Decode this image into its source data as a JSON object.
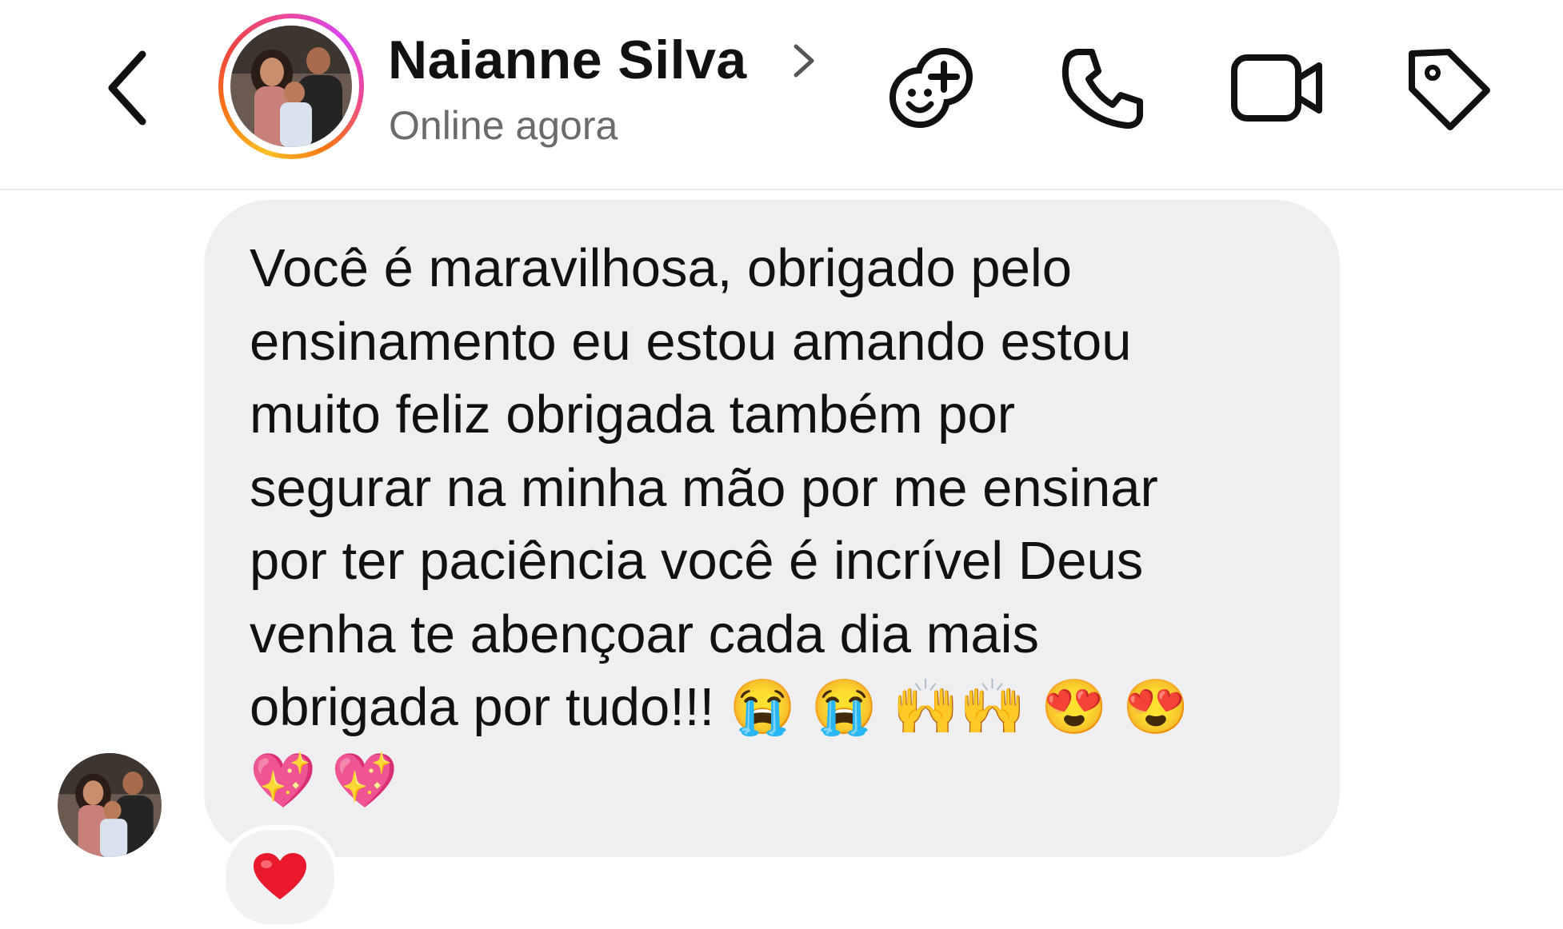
{
  "header": {
    "contact_name": "Naianne Silva",
    "status": "Online agora",
    "icons": [
      "back-chevron-icon",
      "profile-chevron-icon",
      "add-people-icon",
      "phone-icon",
      "video-camera-icon",
      "tag-icon"
    ]
  },
  "message": {
    "text": "Você é maravilhosa, obrigado pelo\nensinamento eu estou amando estou\nmuito feliz obrigada também por\nsegurar na minha mão por me ensinar\npor ter paciência você é incrível Deus\nvenha te abençoar cada dia mais\nobrigada por tudo!!! 😭 😭 🙌🙌 😍 😍\n💖 💖",
    "reaction": "❤️"
  },
  "colors": {
    "bubble": "#efeff1",
    "status_text": "#6b6b6b",
    "divider": "#ececec",
    "ring_gradient": [
      "#fbbf24",
      "#f97316",
      "#ec4899",
      "#d946ef"
    ]
  }
}
